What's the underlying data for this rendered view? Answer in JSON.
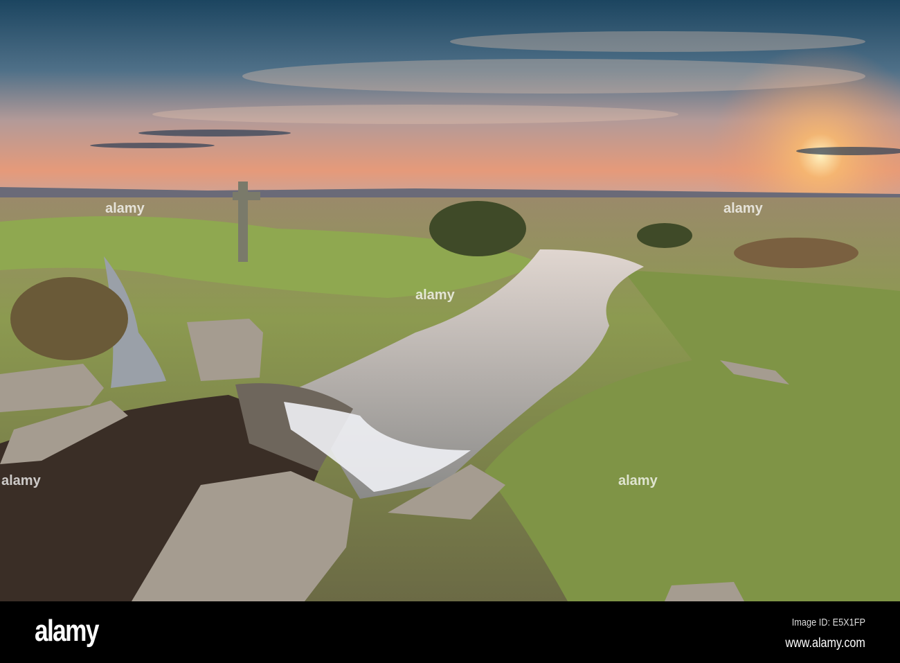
{
  "photo": {
    "subject": "moorland stream with waterfall and stone cross at sunset",
    "colors": {
      "sky_top": "#1f4a66",
      "sky_glow": "#f0a070",
      "grass": "#7f9a48",
      "water": "#c8c4c0"
    }
  },
  "watermark": {
    "text": "alamy"
  },
  "footer": {
    "logo": "alamy",
    "image_id": "Image ID: E5X1FP",
    "website": "www.alamy.com"
  }
}
